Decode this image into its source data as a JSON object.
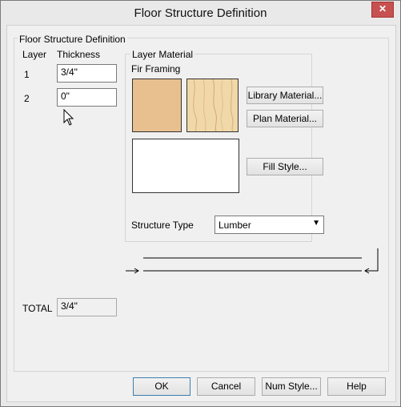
{
  "window": {
    "title": "Floor Structure Definition",
    "close_label": "✕"
  },
  "definition": {
    "group_title": "Floor Structure Definition",
    "col_layer": "Layer",
    "col_thickness": "Thickness",
    "layers": [
      {
        "number": "1",
        "thickness": "3/4\""
      },
      {
        "number": "2",
        "thickness": "0\""
      }
    ],
    "total_label": "TOTAL",
    "total_value": "3/4\""
  },
  "material": {
    "group_title": "Layer Material",
    "name": "Fir Framing",
    "library_button": "Library Material...",
    "plan_button": "Plan Material...",
    "fill_button": "Fill Style...",
    "structure_type_label": "Structure Type",
    "structure_type_value": "Lumber",
    "colors": {
      "flat": "#e8c08f",
      "texture": "#f1d8a8",
      "fill": "#ffffff"
    }
  },
  "footer": {
    "ok": "OK",
    "cancel": "Cancel",
    "num_style": "Num Style...",
    "help": "Help"
  }
}
